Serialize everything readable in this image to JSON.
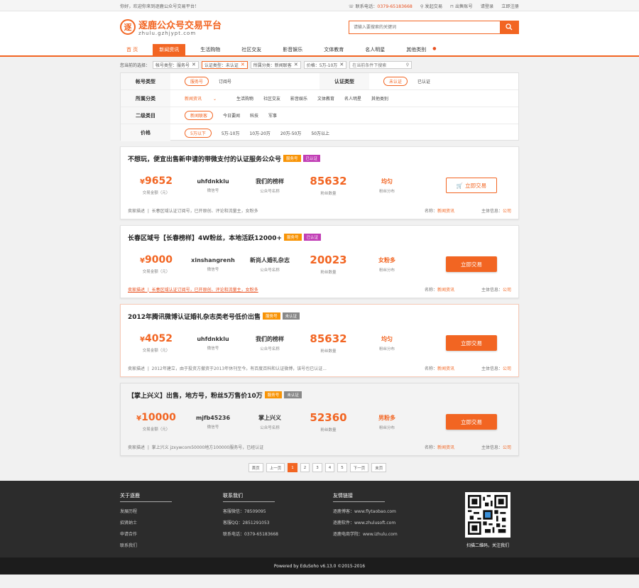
{
  "topbar": {
    "greeting": "你好，欢迎你来到逐鹿公众号交易平台！",
    "phone_label": "联系电话：",
    "phone": "0379-65183668",
    "publish": "发起交易",
    "sell": "出售账号",
    "login": "请登录",
    "register": "立即注册"
  },
  "logo": {
    "mark": "逐",
    "cn": "逐鹿公众号交易平台",
    "en": "zhulu.gzhjypt.com"
  },
  "search": {
    "placeholder": "请输入要搜索的关键词"
  },
  "nav": [
    "首 页",
    "新闻资讯",
    "生活购物",
    "社区交友",
    "影音娱乐",
    "文体教育",
    "名人明星",
    "其他类别"
  ],
  "selected": {
    "label": "您当前的选择：",
    "chips": [
      "帐号类型：服务号",
      "认证类型：未认证",
      "所属分类：新闻联客",
      "价格：5万-10万"
    ],
    "search_placeholder": "在当前条件下搜索"
  },
  "filter": {
    "account_type": {
      "label": "帐号类型",
      "options": [
        "服务号",
        "订阅号"
      ]
    },
    "cert_type": {
      "label": "认证类型",
      "options": [
        "未认证",
        "已认证"
      ]
    },
    "category": {
      "label": "所属分类",
      "options": [
        "新闻资讯",
        "生活购物",
        "社区交友",
        "影音娱乐",
        "文体教育",
        "名人明星",
        "其他类别"
      ]
    },
    "sub_category": {
      "label": "二级类目",
      "options": [
        "新闻联客",
        "今日要闻",
        "科技",
        "军事"
      ]
    },
    "price": {
      "label": "价格",
      "options": [
        "5万以下",
        "5万-10万",
        "10万-20万",
        "20万-50万",
        "50万以上"
      ]
    }
  },
  "labels": {
    "price": "交易金额（元）",
    "wechat": "微信号",
    "name": "公众号名称",
    "fans": "粉丝数量",
    "dist": "粉丝分布",
    "desc": "卖家描述",
    "cat_name": "名称：",
    "owner": "主体信息：",
    "yen": "¥"
  },
  "listings": [
    {
      "title": "不想玩，便宜出售新申请的带微支付的认证服务公众号",
      "tag1": "服务号",
      "tag2": "已认证",
      "price": "9652",
      "wechat": "uhfdnkklu",
      "name": "我们的榜样",
      "fans": "85632",
      "dist": "均匀",
      "btn": "立即交易",
      "desc": "长春区域认证订阅号，已开原创、评论和流量主，女粉多",
      "cat": "新闻资讯",
      "owner": "公司"
    },
    {
      "title": "长春区域号【长春榜样】4W粉丝，本地活跃12000+",
      "tag1": "服务号",
      "tag2": "已认证",
      "price": "9000",
      "wechat": "xinshangrenh",
      "name": "新尚人婚礼杂志",
      "fans": "20023",
      "dist": "女粉多",
      "btn": "立即交易",
      "desc": "长春区域认证订阅号，已开原创、评论和流量主，女粉多",
      "cat": "新闻资讯",
      "owner": "公司"
    },
    {
      "title": "2012年腾讯微博认证婚礼杂志类老号低价出售",
      "tag1": "服务号",
      "tag2": "未认证",
      "price": "4052",
      "wechat": "uhfdnkklu",
      "name": "我们的榜样",
      "fans": "85632",
      "dist": "均匀",
      "btn": "立即交易",
      "desc": "2012年建立，由于投资方撤资于2013年休刊至今。有百度百科和认证微博，该号也已认证...",
      "cat": "新闻资讯",
      "owner": "公司"
    },
    {
      "title": "【掌上兴义】出售，地方号，粉丝5万售价10万",
      "tag1": "服务号",
      "tag2": "未认证",
      "price": "10000",
      "wechat": "mjfb45236",
      "name": "掌上兴义",
      "fans": "52360",
      "dist": "男粉多",
      "btn": "立即交易",
      "desc": "掌上兴义 jzxywcom50000地方100000服务号，已经认证",
      "cat": "新闻资讯",
      "owner": "公司"
    }
  ],
  "pager": [
    "首页",
    "上一页",
    "1",
    "2",
    "3",
    "4",
    "5",
    "下一页",
    "末页"
  ],
  "footer": {
    "about": {
      "title": "关于逐鹿",
      "items": [
        "发展历程",
        "招贤纳士",
        "申请合作",
        "联系我们"
      ]
    },
    "contact": {
      "title": "联系我们",
      "items": [
        "客服微信：78509095",
        "客服QQ：2851291053",
        "联系电话：0379-65183668"
      ]
    },
    "links": {
      "title": "友情链接",
      "items": [
        "逐鹿博客：www.flytaobao.com",
        "逐鹿软件：www.zhulusoft.com",
        "逐鹿电商学院：www.izhulu.com"
      ]
    },
    "qr_text": "扫描二维码，关注我们",
    "powered": "Powered by EduSoho v6.13.0 ©2015-2016"
  },
  "colors": {
    "accent": "#f26522"
  }
}
